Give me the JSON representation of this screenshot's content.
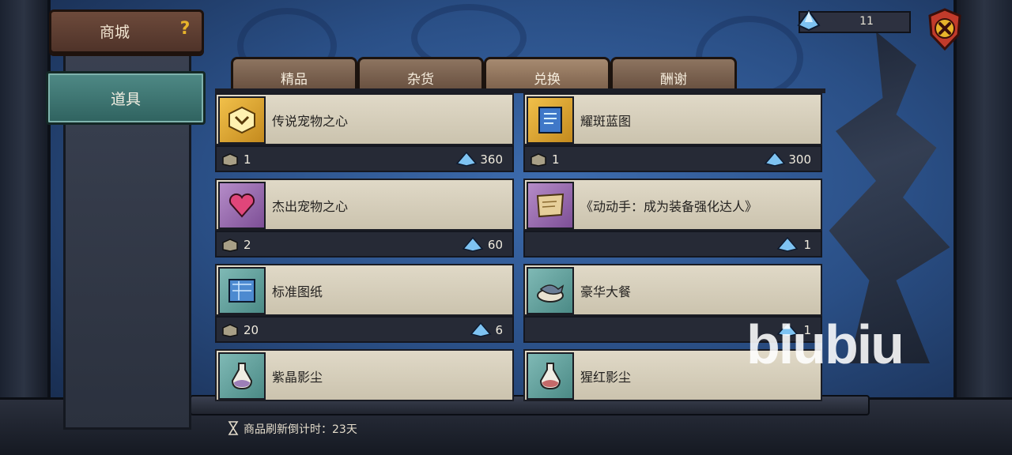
{
  "shop": {
    "title": "商城",
    "help_icon": "?"
  },
  "sidebar": {
    "category": "道具"
  },
  "currency": {
    "amount": "11",
    "icon": "blue-crystal-icon"
  },
  "tabs": [
    {
      "label": "精品"
    },
    {
      "label": "杂货"
    },
    {
      "label": "兑换"
    },
    {
      "label": "酬谢"
    }
  ],
  "items": [
    {
      "name": "传说宠物之心",
      "qty": "1",
      "price": "360",
      "icon": "golden-heart-icon"
    },
    {
      "name": "耀斑蓝图",
      "qty": "1",
      "price": "300",
      "icon": "blue-scroll-icon"
    },
    {
      "name": "杰出宠物之心",
      "qty": "2",
      "price": "60",
      "icon": "pink-heart-icon"
    },
    {
      "name": "《动动手：成为装备强化达人》",
      "qty": "",
      "price": "1",
      "icon": "parchment-icon"
    },
    {
      "name": "标准图纸",
      "qty": "20",
      "price": "6",
      "icon": "blueprint-map-icon"
    },
    {
      "name": "豪华大餐",
      "qty": "",
      "price": "1",
      "icon": "fish-meal-icon"
    },
    {
      "name": "紫晶影尘",
      "qty": "",
      "price": "",
      "icon": "purple-dust-bottle-icon"
    },
    {
      "name": "猩红影尘",
      "qty": "",
      "price": "",
      "icon": "red-dust-bottle-icon"
    }
  ],
  "footer": {
    "refresh": "商品刷新倒计时：23天"
  },
  "watermark": "biubiu",
  "colors": {
    "background": "#2a4f86",
    "tab": "#7a5e49",
    "accent": "#e8b42b"
  }
}
